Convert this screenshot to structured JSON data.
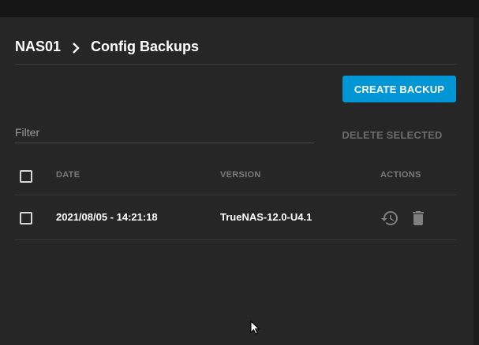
{
  "breadcrumb": {
    "root": "NAS01",
    "current": "Config Backups"
  },
  "toolbar": {
    "create_label": "CREATE BACKUP",
    "delete_selected_label": "DELETE SELECTED"
  },
  "filter": {
    "placeholder": "Filter"
  },
  "table": {
    "columns": [
      "DATE",
      "VERSION",
      "ACTIONS"
    ],
    "rows": [
      {
        "date": "2021/08/05 - 14:21:18",
        "version": "TrueNAS-12.0-U4.1",
        "actions": [
          "restore-icon",
          "delete-icon"
        ]
      }
    ]
  },
  "colors": {
    "accent": "#0095d5",
    "panel": "#262626",
    "text": "#ffffff",
    "muted": "#7a7a7a"
  }
}
